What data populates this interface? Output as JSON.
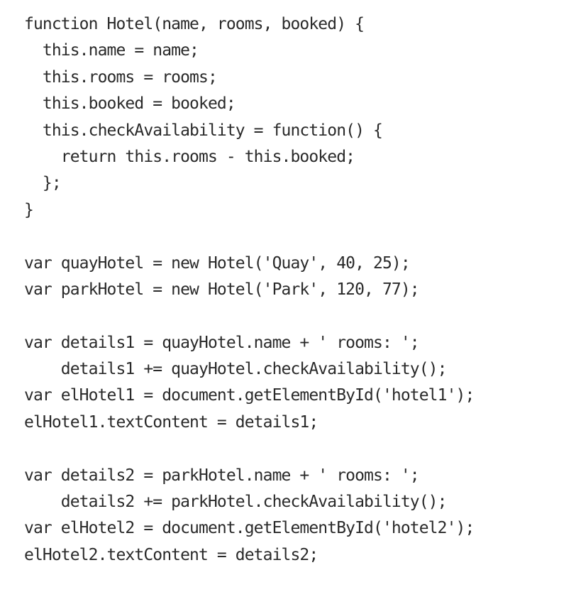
{
  "code": {
    "lines": [
      "function Hotel(name, rooms, booked) {",
      "  this.name = name;",
      "  this.rooms = rooms;",
      "  this.booked = booked;",
      "  this.checkAvailability = function() {",
      "    return this.rooms - this.booked;",
      "  };",
      "}",
      "",
      "var quayHotel = new Hotel('Quay', 40, 25);",
      "var parkHotel = new Hotel('Park', 120, 77);",
      "",
      "var details1 = quayHotel.name + ' rooms: ';",
      "    details1 += quayHotel.checkAvailability();",
      "var elHotel1 = document.getElementById('hotel1');",
      "elHotel1.textContent = details1;",
      "",
      "var details2 = parkHotel.name + ' rooms: ';",
      "    details2 += parkHotel.checkAvailability();",
      "var elHotel2 = document.getElementById('hotel2');",
      "elHotel2.textContent = details2;"
    ]
  }
}
